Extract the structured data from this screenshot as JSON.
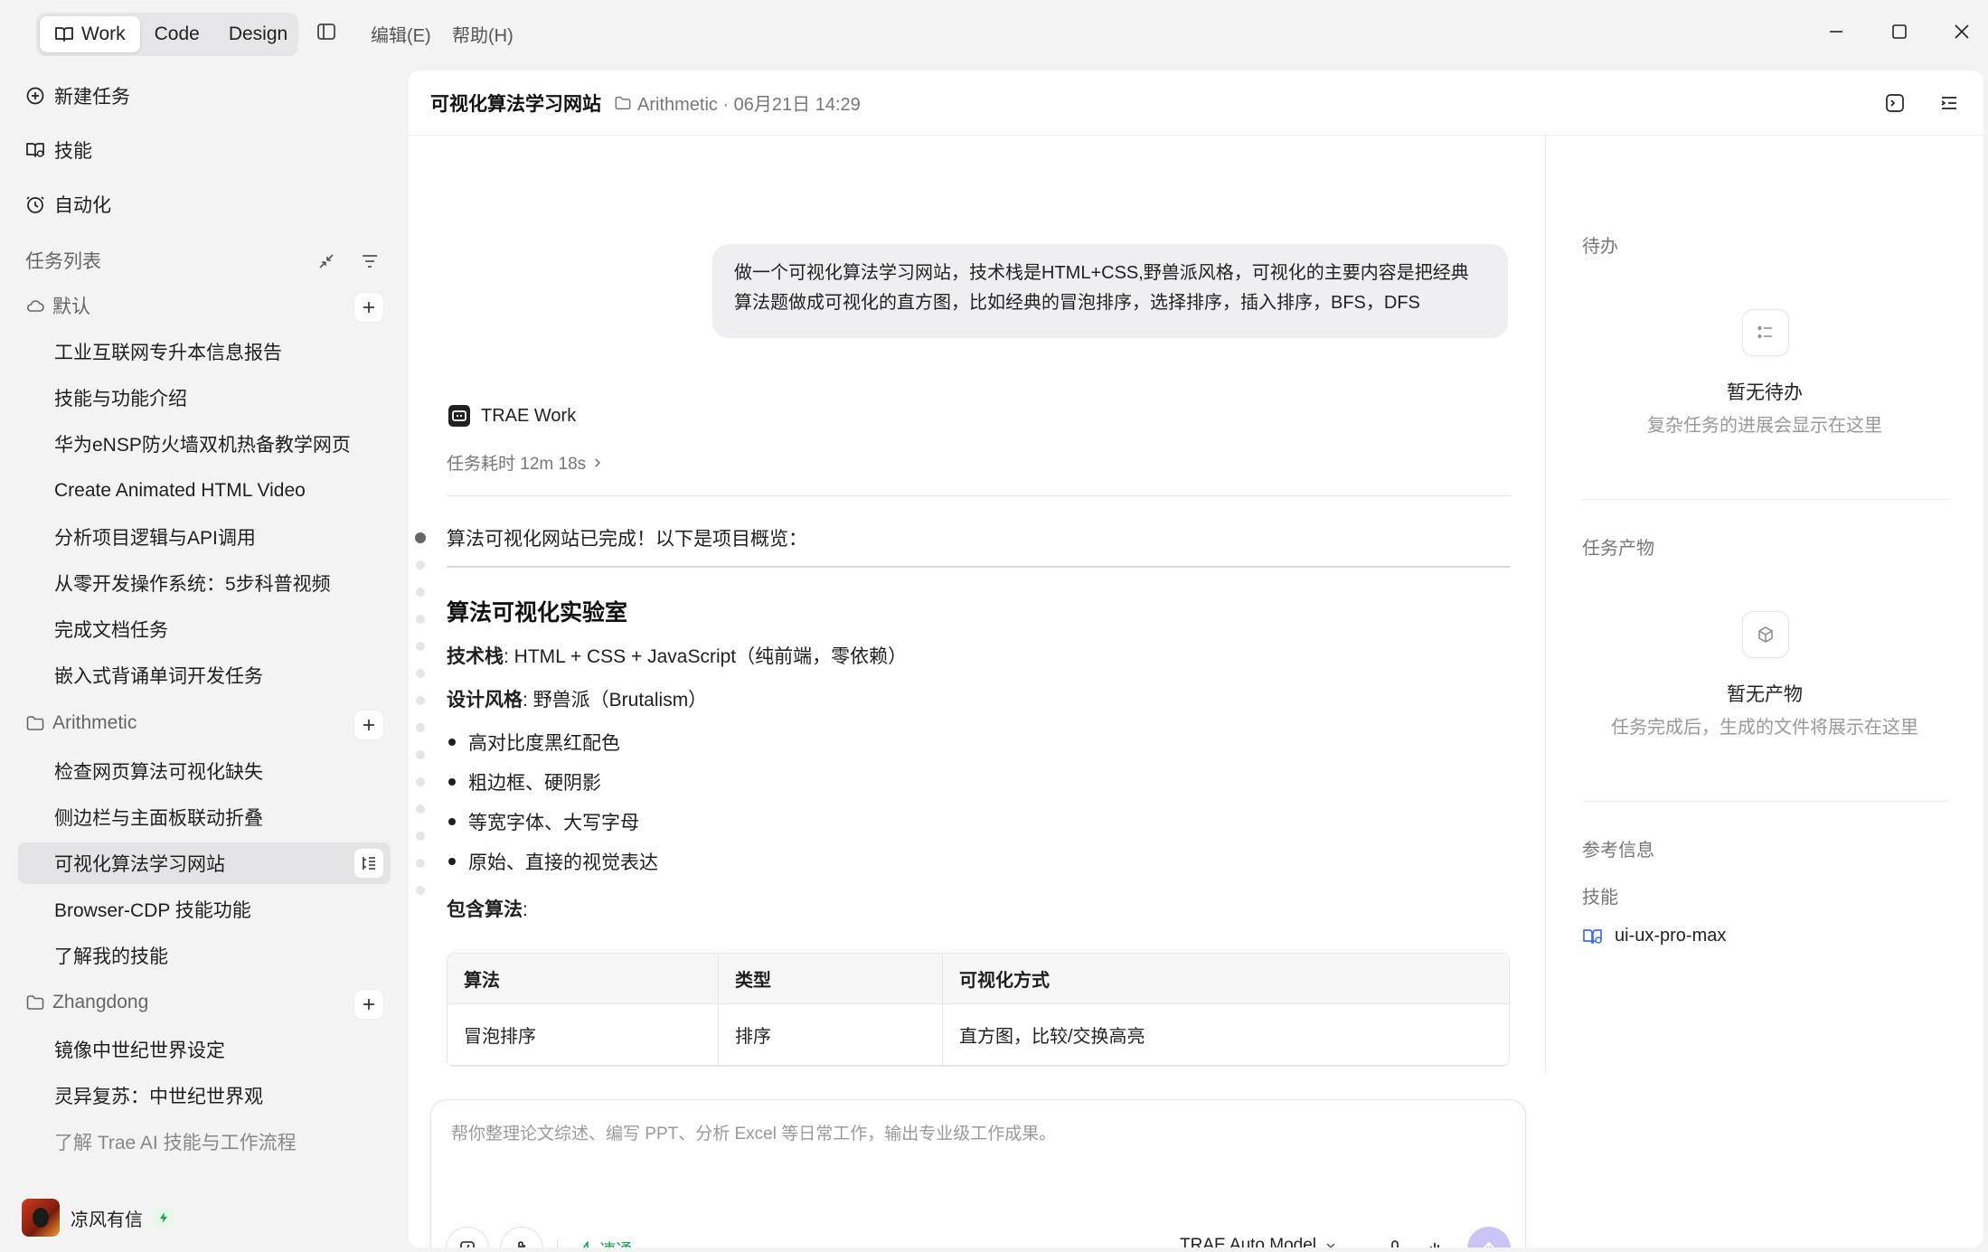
{
  "titlebar": {
    "modes": [
      "Work",
      "Code",
      "Design"
    ],
    "active_mode": "Work",
    "menu": [
      "编辑(E)",
      "帮助(H)"
    ]
  },
  "sidebar": {
    "nav": {
      "new_task": "新建任务",
      "skills": "技能",
      "automation": "自动化"
    },
    "task_list_title": "任务列表",
    "groups": [
      {
        "name": "默认",
        "items": [
          "工业互联网专升本信息报告",
          "技能与功能介绍",
          "华为eNSP防火墙双机热备教学网页",
          "Create Animated HTML Video",
          "分析项目逻辑与API调用",
          "从零开发操作系统：5步科普视频",
          "完成文档任务",
          "嵌入式背诵单词开发任务"
        ]
      },
      {
        "name": "Arithmetic",
        "items": [
          "检查网页算法可视化缺失",
          "侧边栏与主面板联动折叠",
          "可视化算法学习网站",
          "Browser-CDP 技能功能",
          "了解我的技能"
        ]
      },
      {
        "name": "Zhangdong",
        "items": [
          "镜像中世纪世界设定",
          "灵异复苏：中世纪世界观",
          "了解 Trae AI 技能与工作流程"
        ]
      }
    ],
    "active_item": "可视化算法学习网站",
    "user": {
      "name": "凉风有信"
    }
  },
  "main": {
    "title": "可视化算法学习网站",
    "meta": "Arithmetic · 06月21日 14:29",
    "user_message": "做一个可视化算法学习网站，技术栈是HTML+CSS,野兽派风格，可视化的主要内容是把经典算法题做成可视化的直方图，比如经典的冒泡排序，选择排序，插入排序，BFS，DFS",
    "agent_name": "TRAE Work",
    "duration": "任务耗时 12m 18s",
    "summary": "算法可视化网站已完成！以下是项目概览：",
    "doc": {
      "h1": "算法可视化实验室",
      "tech_label": "技术栈",
      "tech_value": ": HTML + CSS + JavaScript（纯前端，零依赖）",
      "style_label": "设计风格",
      "style_value": ": 野兽派（Brutalism）",
      "bullets": [
        "高对比度黑红配色",
        "粗边框、硬阴影",
        "等宽字体、大写字母",
        "原始、直接的视觉表达"
      ],
      "algo_label": "包含算法",
      "algo_colon": ":",
      "table": {
        "headers": [
          "算法",
          "类型",
          "可视化方式"
        ],
        "rows": [
          [
            "冒泡排序",
            "排序",
            "直方图，比较/交换高亮"
          ]
        ]
      }
    },
    "composer": {
      "placeholder": "帮你整理论文综述、编写 PPT、分析 Excel 等日常工作，输出专业级工作成果。",
      "speed": "速通",
      "model": "TRAE Auto Model"
    }
  },
  "right_panel": {
    "todo_title": "待办",
    "todo_empty": "暂无待办",
    "todo_sub": "复杂任务的进展会显示在这里",
    "output_title": "任务产物",
    "output_empty": "暂无产物",
    "output_sub": "任务完成后，生成的文件将展示在这里",
    "ref_title": "参考信息",
    "skill_title": "技能",
    "skill_name": "ui-ux-pro-max"
  },
  "icons": {
    "book": "book-icon",
    "plus_circle": "plus-circle-icon",
    "clock": "clock-icon",
    "cloud": "cloud-icon",
    "folder": "folder-icon",
    "sparkle": "sparkle-icon"
  },
  "colors": {
    "accent_green": "#16a34a",
    "send_button": "#c9c6f6",
    "skill_icon": "#3b6fe0"
  }
}
